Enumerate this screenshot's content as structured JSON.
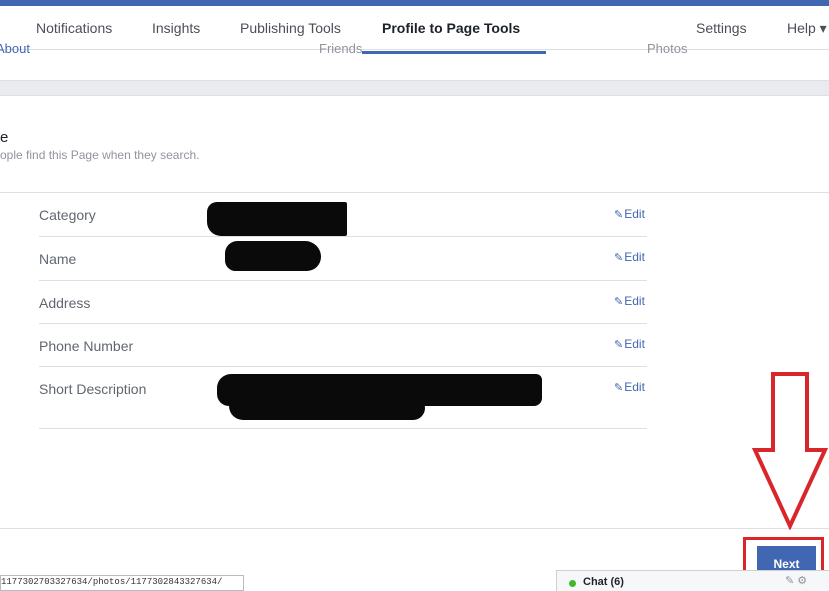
{
  "tabs": [
    {
      "label": "Notifications"
    },
    {
      "label": "Insights"
    },
    {
      "label": "Publishing Tools"
    },
    {
      "label": "Profile to Page Tools",
      "active": true
    },
    {
      "label": "Settings"
    },
    {
      "label": "Help ▾"
    }
  ],
  "subnav": {
    "about": "About",
    "friends": "Friends",
    "photos": "Photos"
  },
  "section": {
    "title": "e",
    "subtitle": "ople find this Page when they search."
  },
  "rows": [
    {
      "label": "Category",
      "edit": "Edit"
    },
    {
      "label": "Name",
      "edit": "Edit"
    },
    {
      "label": "Address",
      "edit": "Edit"
    },
    {
      "label": "Phone Number",
      "edit": "Edit"
    },
    {
      "label": "Short Description",
      "edit": "Edit"
    }
  ],
  "next_button": "Next",
  "url_text": "1177302703327634/photos/1177302843327634/",
  "chat": {
    "label": "Chat (6)"
  },
  "colors": {
    "accent": "#4267b2",
    "annotation": "#d8262a",
    "online": "#42b72a"
  }
}
